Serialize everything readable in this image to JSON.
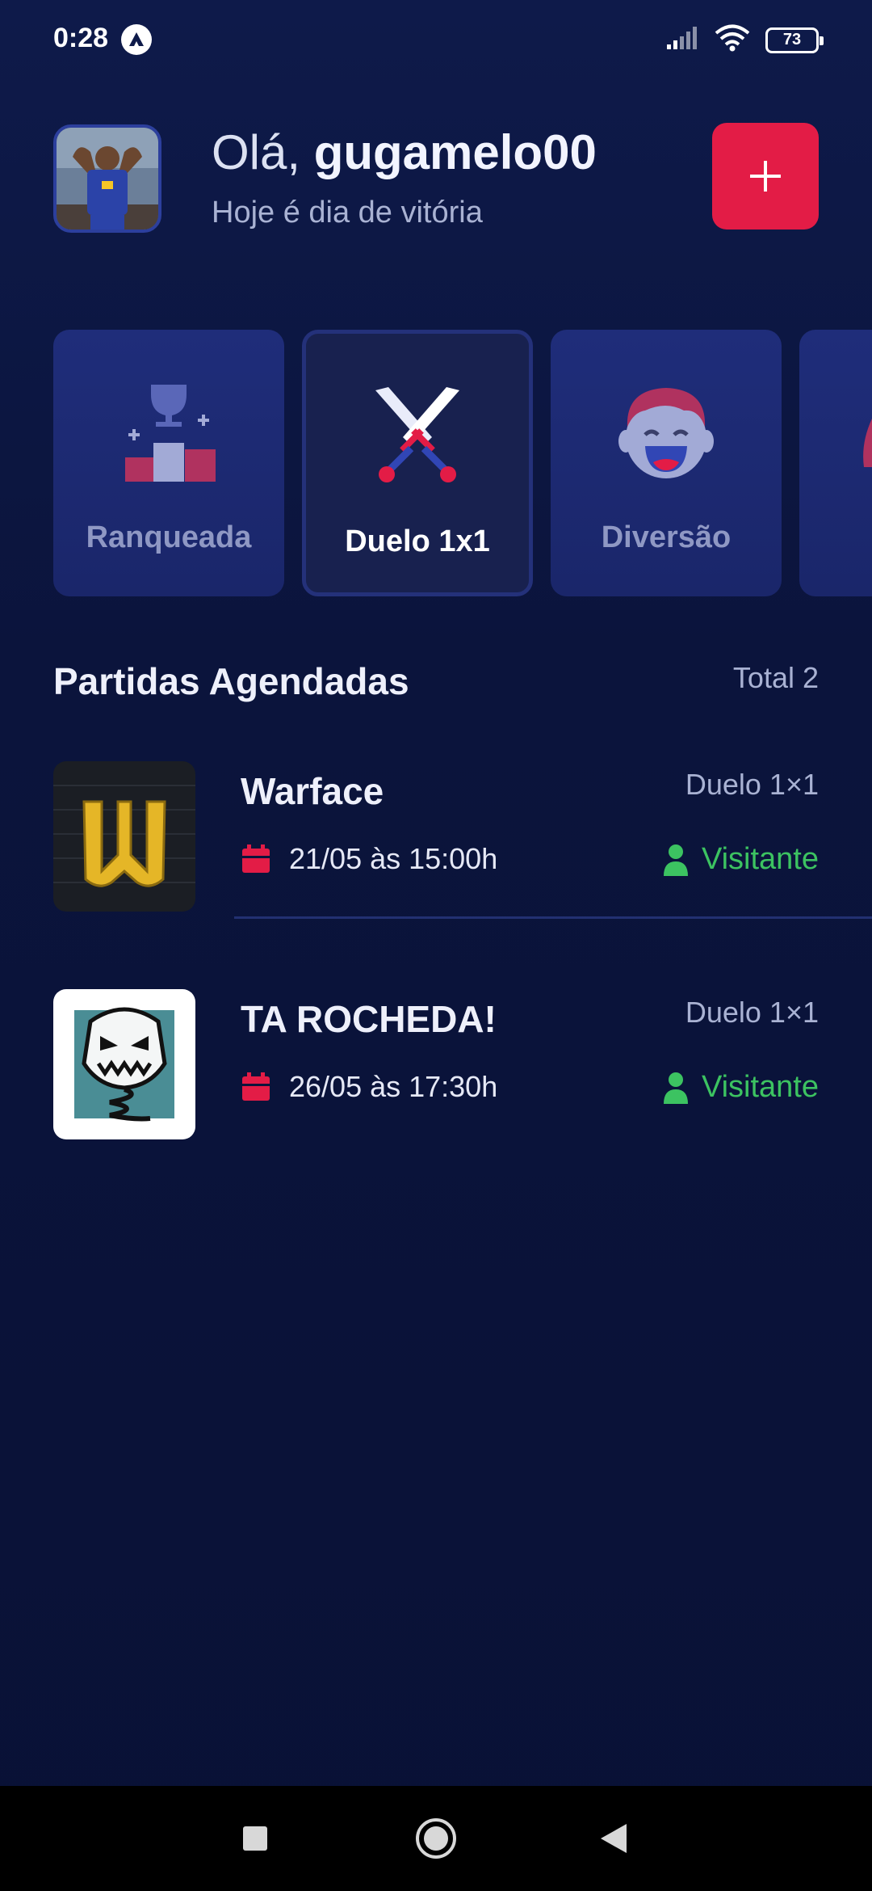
{
  "status_bar": {
    "time": "0:28",
    "battery": "73"
  },
  "header": {
    "greeting_prefix": "Olá,",
    "username": "gugamelo00",
    "subtitle": "Hoje é dia de vitória"
  },
  "categories": [
    {
      "label": "Ranqueada",
      "icon": "trophy-podium-icon",
      "selected": false
    },
    {
      "label": "Duelo 1x1",
      "icon": "crossed-swords-icon",
      "selected": true
    },
    {
      "label": "Diversão",
      "icon": "laughing-face-icon",
      "selected": false
    }
  ],
  "section": {
    "title": "Partidas Agendadas",
    "total": "Total 2"
  },
  "matches": [
    {
      "name": "Warface",
      "mode": "Duelo 1×1",
      "date": "21/05 às 15:00h",
      "role": "Visitante"
    },
    {
      "name": "TA ROCHEDA!",
      "mode": "Duelo 1×1",
      "date": "26/05 às 17:30h",
      "role": "Visitante"
    }
  ],
  "colors": {
    "accent": "#e31c46",
    "background": "#0b143c",
    "card": "#1f2d7a",
    "role": "#3cc361"
  }
}
